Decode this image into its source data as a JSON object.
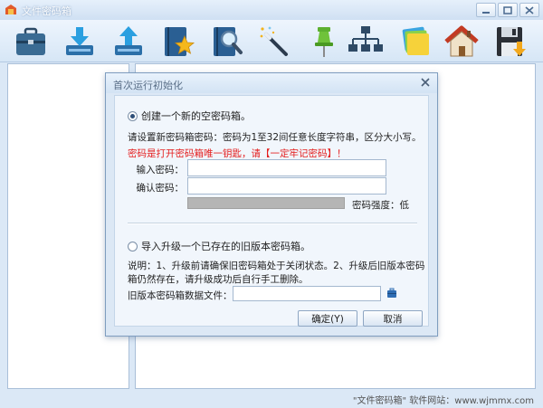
{
  "window": {
    "title": "文件密码箱"
  },
  "toolbar": {
    "icons": [
      "briefcase-icon",
      "download-icon",
      "upload-icon",
      "notebook-star-icon",
      "notebook-search-icon",
      "magic-wand-icon",
      "pushpin-icon",
      "sitemap-icon",
      "folders-icon",
      "home-icon",
      "save-disk-icon"
    ]
  },
  "dialog": {
    "title": "首次运行初始化",
    "new_option": "创建一个新的空密码箱。",
    "hint": "请设置新密码箱密码：密码为1至32间任意长度字符串，区分大小写。",
    "warning": "密码是打开密码箱唯一钥匙，请【一定牢记密码】！",
    "password_label": "输入密码：",
    "password_value": "",
    "confirm_label": "确认密码：",
    "confirm_value": "",
    "strength_label": "密码强度：低",
    "strength_fraction": 0,
    "import_option": "导入升级一个已存在的旧版本密码箱。",
    "import_note_line1": "说明：1、升级前请确保旧密码箱处于关闭状态。2、升级后旧版本密码",
    "import_note_line2": "箱仍然存在，请升级成功后自行手工删除。",
    "old_file_label": "旧版本密码箱数据文件：",
    "old_file_value": "",
    "ok_label": "确定(Y)",
    "cancel_label": "取消"
  },
  "status": {
    "text": "\"文件密码箱\" 软件网站：www.wjmmx.com"
  },
  "colors": {
    "warning": "#e41e1e",
    "accent": "#2f6db3"
  }
}
